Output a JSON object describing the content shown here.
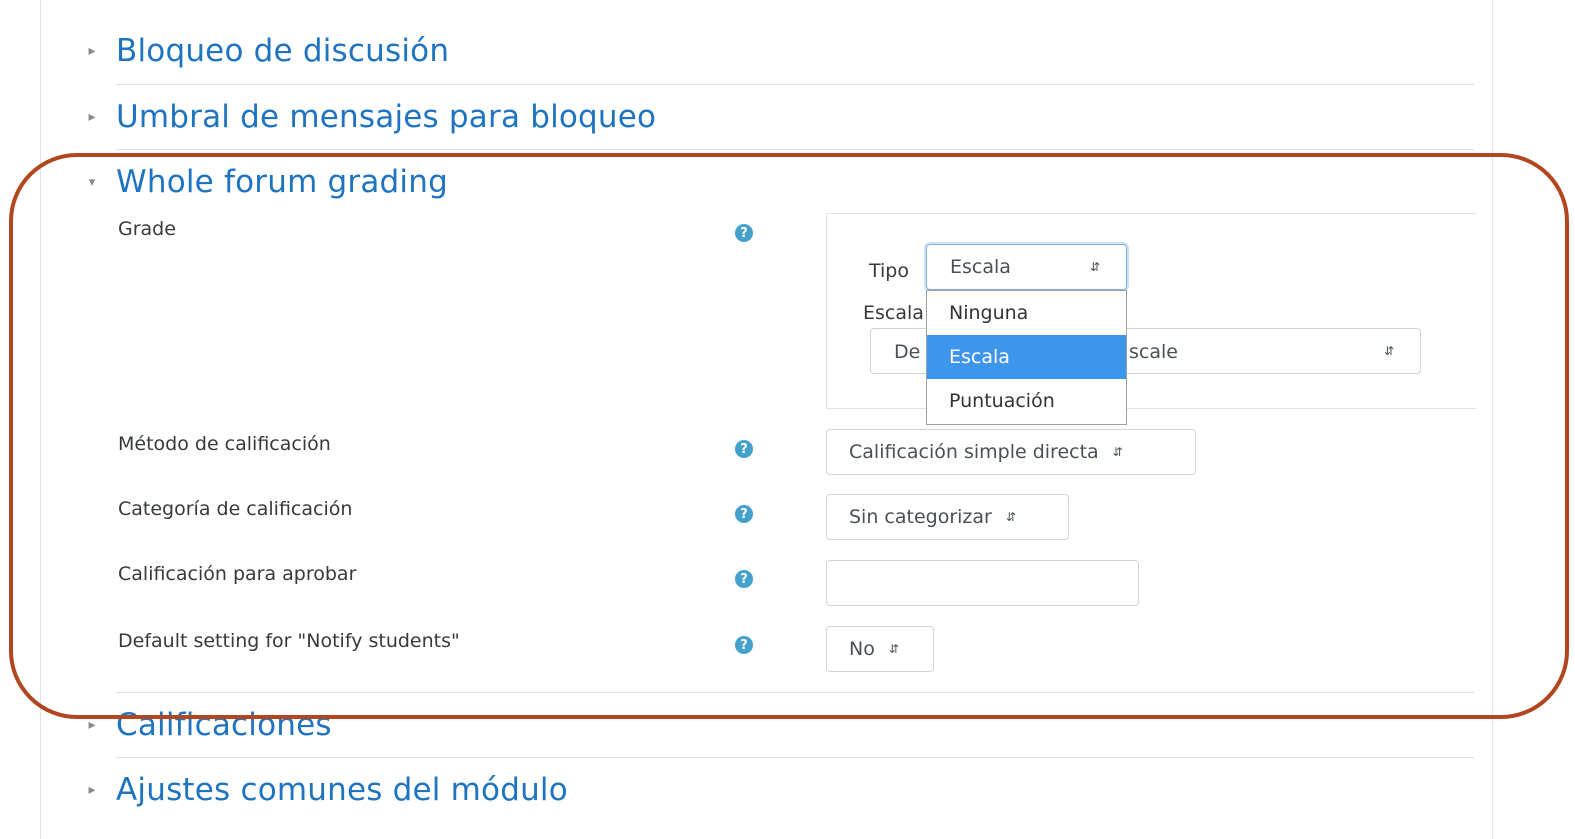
{
  "sections": {
    "bloqueo": "Bloqueo de discusión",
    "umbral": "Umbral de mensajes para bloqueo",
    "whole_forum": "Whole forum grading",
    "calificaciones": "Calificaciones",
    "ajustes": "Ajustes comunes del módulo"
  },
  "grade": {
    "label": "Grade",
    "tipo_label": "Tipo",
    "tipo_value": "Escala",
    "escala_label": "Escala",
    "scale_value_head": "De",
    "scale_value_tail": "scale",
    "dropdown_options": [
      "Ninguna",
      "Escala",
      "Puntuación"
    ],
    "dropdown_selected": "Escala"
  },
  "fields": {
    "metodo_label": "Método de calificación",
    "metodo_value": "Calificación simple directa",
    "categoria_label": "Categoría de calificación",
    "categoria_value": "Sin categorizar",
    "aprobar_label": "Calificación para aprobar",
    "aprobar_value": "",
    "notify_label": "Default setting for \"Notify students\"",
    "notify_value": "No"
  },
  "icons": {
    "collapsed": "triangle-right-icon",
    "expanded": "triangle-down-icon",
    "help": "question-circle-icon",
    "select_caret": "up-down-caret-icon"
  },
  "colors": {
    "link": "#1f74c2",
    "help": "#43a1cc",
    "selected_option": "#3e95ec",
    "highlight_outline": "#b2471f"
  }
}
